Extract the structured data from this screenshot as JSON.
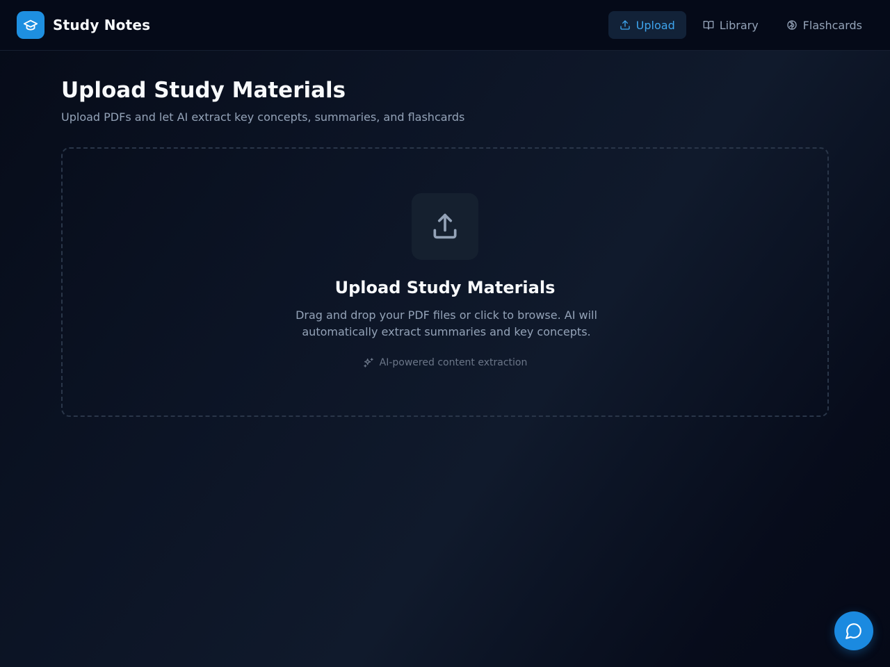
{
  "app": {
    "name": "Study Notes",
    "logo_icon": "graduation-cap-icon",
    "accent_color": "#1e8fe0"
  },
  "nav": {
    "items": [
      {
        "label": "Upload",
        "icon": "upload-icon",
        "active": true
      },
      {
        "label": "Library",
        "icon": "book-open-icon",
        "active": false
      },
      {
        "label": "Flashcards",
        "icon": "brain-icon",
        "active": false
      }
    ]
  },
  "page": {
    "title": "Upload Study Materials",
    "subtitle": "Upload PDFs and let AI extract key concepts, summaries, and flashcards"
  },
  "dropzone": {
    "icon": "upload-icon",
    "title": "Upload Study Materials",
    "description": "Drag and drop your PDF files or click to browse. AI will automatically extract summaries and key concepts.",
    "hint_icon": "sparkles-icon",
    "hint": "AI-powered content extraction"
  },
  "chat_button": {
    "icon": "message-circle-icon"
  }
}
